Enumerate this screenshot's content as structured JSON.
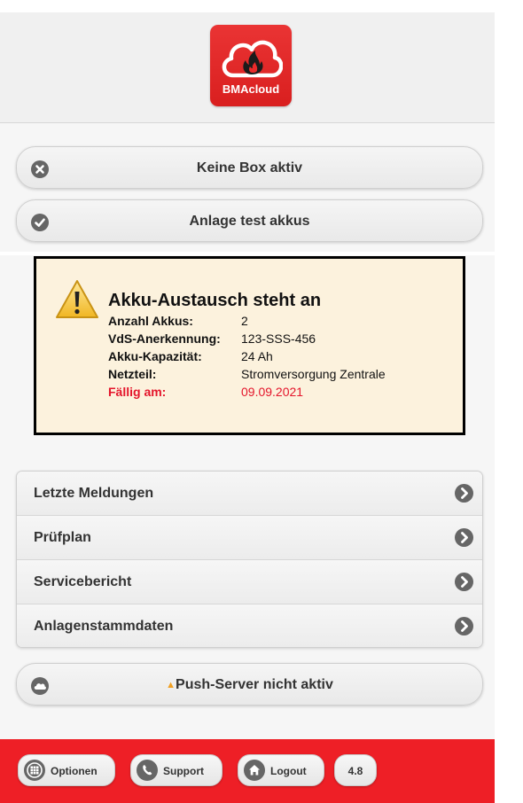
{
  "app": {
    "logo_text": "BMAcloud"
  },
  "status_buttons": {
    "box": {
      "label": "Keine Box aktiv",
      "icon": "x-circle-icon"
    },
    "system": {
      "label": "Anlage test akkus",
      "icon": "check-circle-icon"
    }
  },
  "warning": {
    "title": "Akku-Austausch steht an",
    "rows": [
      {
        "key": "Anzahl Akkus:",
        "value": "2"
      },
      {
        "key": "VdS-Anerkennung:",
        "value": "123-SSS-456"
      },
      {
        "key": "Akku-Kapazität:",
        "value": "24 Ah"
      },
      {
        "key": "Netzteil:",
        "value": "Stromversorgung Zentrale"
      },
      {
        "key": "Fällig am:",
        "value": "09.09.2021"
      }
    ],
    "due_color": "#e4152b"
  },
  "menu": {
    "items": [
      {
        "label": "Letzte Meldungen"
      },
      {
        "label": "Prüfplan"
      },
      {
        "label": "Servicebericht"
      },
      {
        "label": "Anlagenstammdaten"
      }
    ]
  },
  "push": {
    "warning_symbol": "▲",
    "label": "Push-Server nicht aktiv",
    "icon": "cloud-icon"
  },
  "footer": {
    "options_label": "Optionen",
    "support_label": "Support",
    "logout_label": "Logout",
    "version": "4.8",
    "background": "#ee1f26"
  }
}
